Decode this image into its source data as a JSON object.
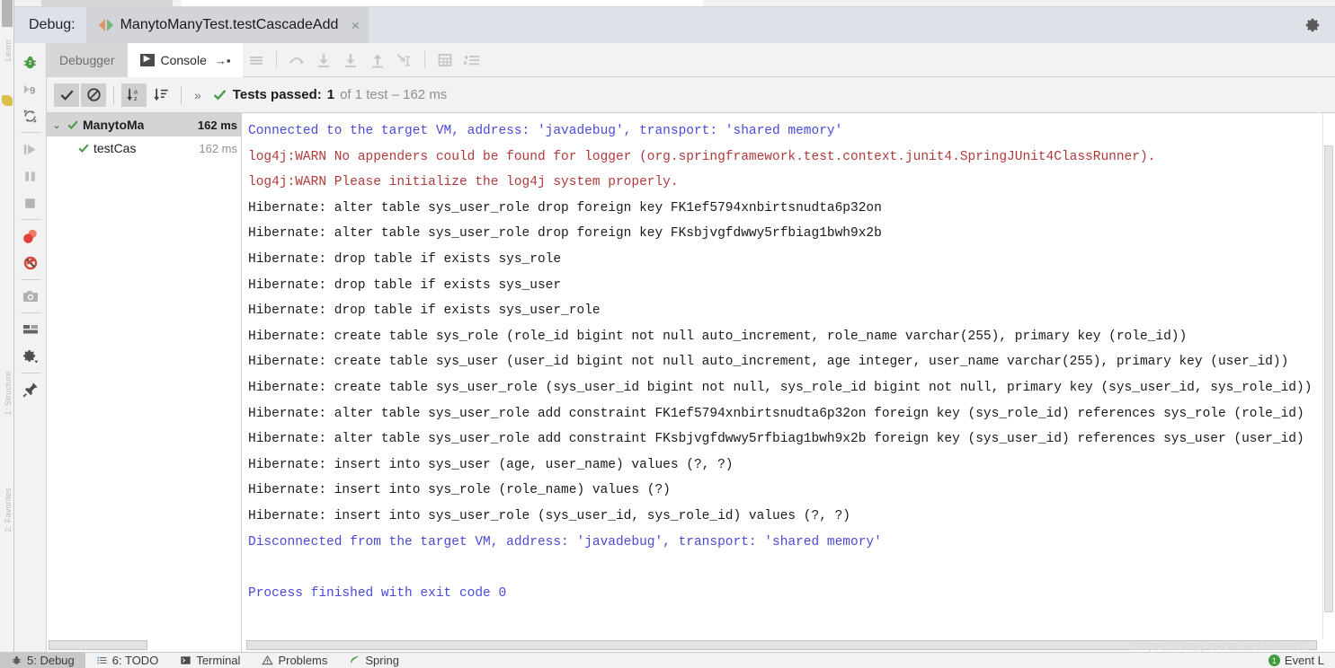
{
  "window": {
    "debug_label": "Debug:",
    "run_tab_title": "ManytoManyTest.testCascadeAdd",
    "close_symbol": "×",
    "settings_icon": "gear-icon"
  },
  "toolwindow": {
    "tabs": [
      {
        "label": "Debugger",
        "active": false,
        "icon": ""
      },
      {
        "label": "Console",
        "active": true,
        "icon": "console-icon"
      }
    ],
    "pin_arrow": "→▪",
    "debug_buttons": [
      "show-execution-point-icon",
      "step-over-icon",
      "step-into-icon",
      "force-step-into-icon",
      "step-out-icon",
      "run-to-cursor-icon",
      "evaluate-expression-icon",
      "show-arguments-icon"
    ]
  },
  "test_toolbar": {
    "buttons": [
      "hide-passed-icon",
      "ignore-tests-icon",
      "sort-alphabetically-icon",
      "sort-duration-icon"
    ],
    "overflow": "»",
    "status_prefix": "Tests passed:",
    "status_count": "1",
    "status_suffix": "of 1 test – 162 ms"
  },
  "test_tree": {
    "rows": [
      {
        "name": "ManytoMa",
        "time": "162 ms",
        "selected": true,
        "indent": 0,
        "twisty": "⌄"
      },
      {
        "name": "testCas",
        "time": "162 ms",
        "selected": false,
        "indent": 1,
        "twisty": ""
      }
    ]
  },
  "console": {
    "lines": [
      {
        "color": "blue",
        "text": "Connected to the target VM, address: 'javadebug', transport: 'shared memory'"
      },
      {
        "color": "red",
        "text": "log4j:WARN No appenders could be found for logger (org.springframework.test.context.junit4.SpringJUnit4ClassRunner)."
      },
      {
        "color": "red",
        "text": "log4j:WARN Please initialize the log4j system properly."
      },
      {
        "color": "black",
        "text": "Hibernate: alter table sys_user_role drop foreign key FK1ef5794xnbirtsnudta6p32on"
      },
      {
        "color": "black",
        "text": "Hibernate: alter table sys_user_role drop foreign key FKsbjvgfdwwy5rfbiag1bwh9x2b"
      },
      {
        "color": "black",
        "text": "Hibernate: drop table if exists sys_role"
      },
      {
        "color": "black",
        "text": "Hibernate: drop table if exists sys_user"
      },
      {
        "color": "black",
        "text": "Hibernate: drop table if exists sys_user_role"
      },
      {
        "color": "black",
        "text": "Hibernate: create table sys_role (role_id bigint not null auto_increment, role_name varchar(255), primary key (role_id))"
      },
      {
        "color": "black",
        "text": "Hibernate: create table sys_user (user_id bigint not null auto_increment, age integer, user_name varchar(255), primary key (user_id))"
      },
      {
        "color": "black",
        "text": "Hibernate: create table sys_user_role (sys_user_id bigint not null, sys_role_id bigint not null, primary key (sys_user_id, sys_role_id))"
      },
      {
        "color": "black",
        "text": "Hibernate: alter table sys_user_role add constraint FK1ef5794xnbirtsnudta6p32on foreign key (sys_role_id) references sys_role (role_id)"
      },
      {
        "color": "black",
        "text": "Hibernate: alter table sys_user_role add constraint FKsbjvgfdwwy5rfbiag1bwh9x2b foreign key (sys_user_id) references sys_user (user_id)"
      },
      {
        "color": "black",
        "text": "Hibernate: insert into sys_user (age, user_name) values (?, ?)"
      },
      {
        "color": "black",
        "text": "Hibernate: insert into sys_role (role_name) values (?)"
      },
      {
        "color": "black",
        "text": "Hibernate: insert into sys_user_role (sys_user_id, sys_role_id) values (?, ?)"
      },
      {
        "color": "blue",
        "text": "Disconnected from the target VM, address: 'javadebug', transport: 'shared memory'"
      },
      {
        "color": "black",
        "text": ""
      },
      {
        "color": "blue",
        "text": "Process finished with exit code 0"
      }
    ]
  },
  "rail": {
    "icons": [
      "debug-bug-icon",
      "resume-step-icon",
      "rerun-icon",
      "resume-program-icon",
      "pause-program-icon",
      "stop-icon",
      "view-breakpoints-icon",
      "mute-breakpoints-icon",
      "camera-icon",
      "layout-icon",
      "settings-gear-icon",
      "pin-icon"
    ]
  },
  "left_strip": {
    "tabs": [
      "Learn",
      "1: Structure",
      "2: Favorites"
    ]
  },
  "statusbar": {
    "items": [
      {
        "label": "5: Debug",
        "icon": "bug-icon",
        "active": true
      },
      {
        "label": "6: TODO",
        "icon": "todo-icon",
        "active": false
      },
      {
        "label": "Terminal",
        "icon": "terminal-icon",
        "active": false
      },
      {
        "label": "Problems",
        "icon": "warning-icon",
        "active": false
      },
      {
        "label": "Spring",
        "icon": "spring-icon",
        "active": false
      }
    ],
    "event_log_label": "Event L",
    "event_log_badge": "1"
  },
  "watermark": "https://blog.csdn.net/xtho62",
  "colors": {
    "tab_bar": "#dee1e8",
    "active_tab": "#d2d4d9",
    "pass_green": "#3f9e3f",
    "console_blue": "#4a4ad8",
    "console_red": "#b03a3a",
    "panel_gray": "#f2f2f2"
  }
}
